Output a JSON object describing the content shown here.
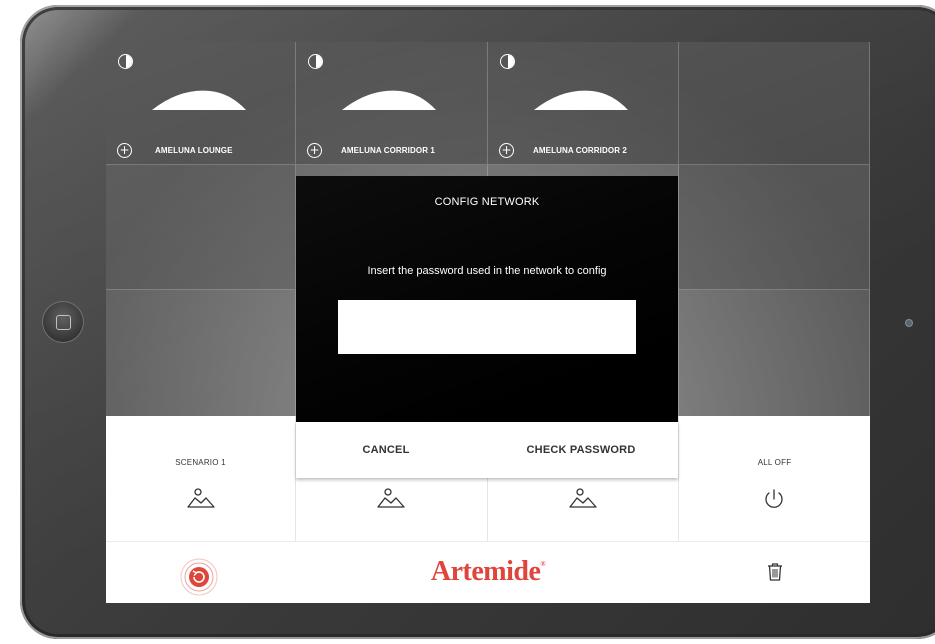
{
  "lights": [
    {
      "label": "AMELUNA LOUNGE",
      "icon": "dimmer-icon"
    },
    {
      "label": "AMELUNA CORRIDOR 1",
      "icon": "dimmer-icon"
    },
    {
      "label": "AMELUNA CORRIDOR 2",
      "icon": "dimmer-icon"
    }
  ],
  "scenes": [
    {
      "label": "SCENARIO 1",
      "icon": "landscape-icon"
    },
    {
      "label": "",
      "icon": "landscape-icon"
    },
    {
      "label": "",
      "icon": "landscape-icon"
    },
    {
      "label": "ALL OFF",
      "icon": "power-icon"
    }
  ],
  "footer": {
    "brand": "Artemide",
    "brand_mark": "®",
    "brand_color": "#e0453c"
  },
  "modal": {
    "title": "CONFIG NETWORK",
    "message": "Insert the password used in the network to config",
    "password_value": "",
    "cancel_label": "CANCEL",
    "confirm_label": "CHECK PASSWORD"
  }
}
